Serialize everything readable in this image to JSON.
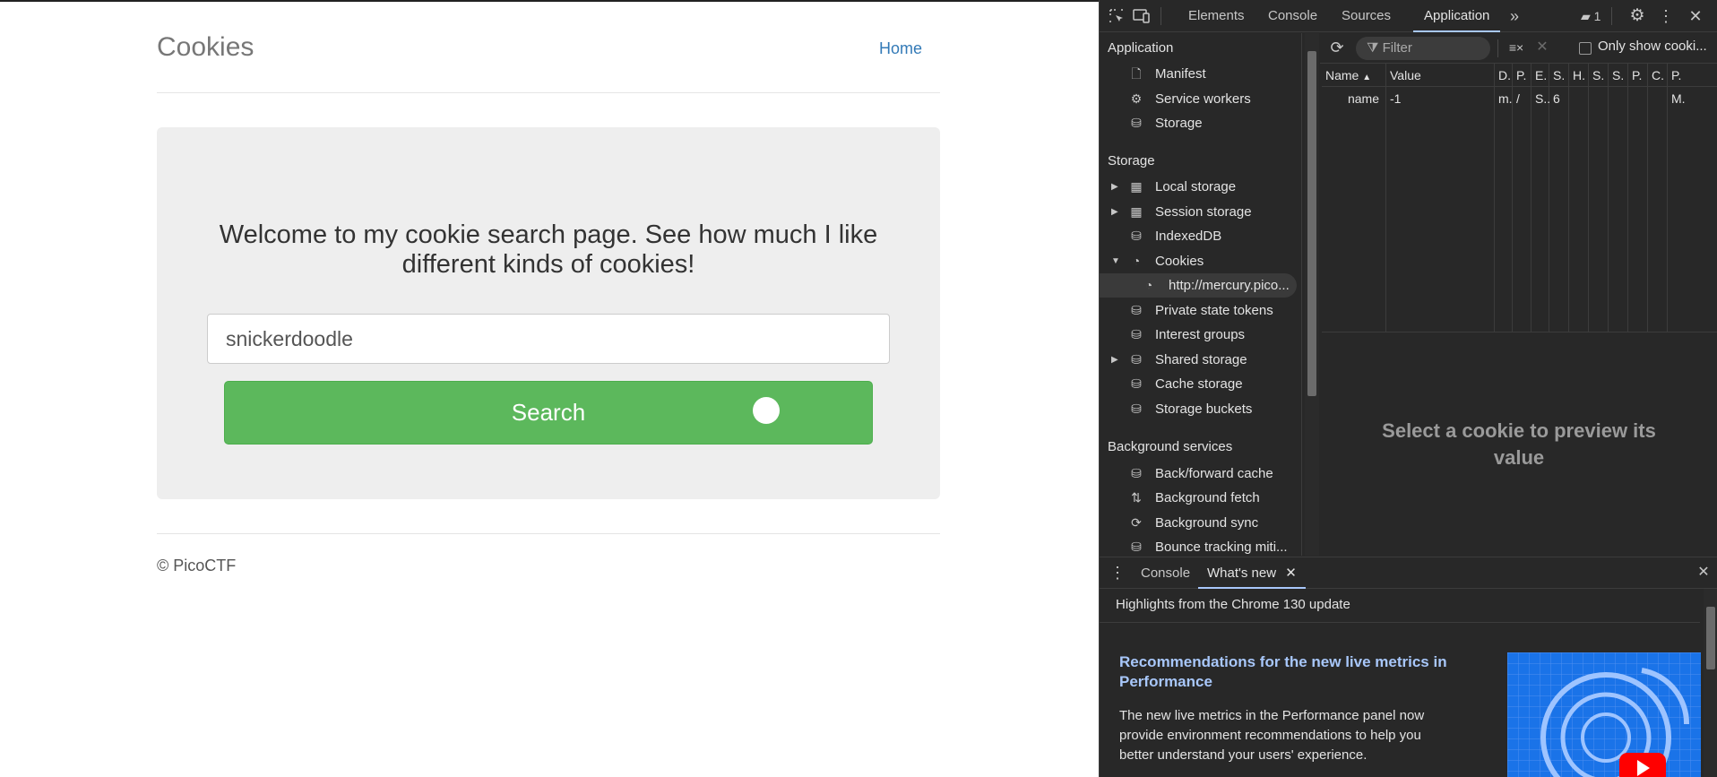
{
  "site": {
    "title": "Cookies",
    "nav_home": "Home",
    "welcome": "Welcome to my cookie search page. See how much I like different kinds of cookies!",
    "search_value": "snickerdoodle",
    "search_button": "Search",
    "footer": "© PicoCTF"
  },
  "devtools": {
    "tabs": [
      "Elements",
      "Console",
      "Sources",
      "Application"
    ],
    "active_tab": "Application",
    "messages_count": "1",
    "sidebar": {
      "section_application": "Application",
      "application_items": [
        "Manifest",
        "Service workers",
        "Storage"
      ],
      "section_storage": "Storage",
      "storage_items": [
        "Local storage",
        "Session storage",
        "IndexedDB",
        "Cookies",
        "http://mercury.pico...",
        "Private state tokens",
        "Interest groups",
        "Shared storage",
        "Cache storage",
        "Storage buckets"
      ],
      "section_background": "Background services",
      "background_items": [
        "Back/forward cache",
        "Background fetch",
        "Background sync",
        "Bounce tracking miti..."
      ]
    },
    "cookies": {
      "filter_placeholder": "Filter",
      "only_show": "Only show cooki...",
      "headers": [
        "Name",
        "Value",
        "D.",
        "P.",
        "E.",
        "S.",
        "H.",
        "S.",
        "S.",
        "P.",
        "C.",
        "P."
      ],
      "rows": [
        {
          "name": "name",
          "value": "-1",
          "domain": "m..",
          "path": "/",
          "expires": "S..",
          "size": "6",
          "partition": "M."
        }
      ],
      "preview_text": "Select a cookie to preview its value"
    },
    "drawer": {
      "tabs": [
        "Console",
        "What's new"
      ],
      "active_tab": "What's new",
      "highlights": "Highlights from the Chrome 130 update",
      "whats_new_title": "Recommendations for the new live metrics in Performance",
      "whats_new_body": "The new live metrics in the Performance panel now provide environment recommendations to help you better understand your users' experience."
    }
  }
}
